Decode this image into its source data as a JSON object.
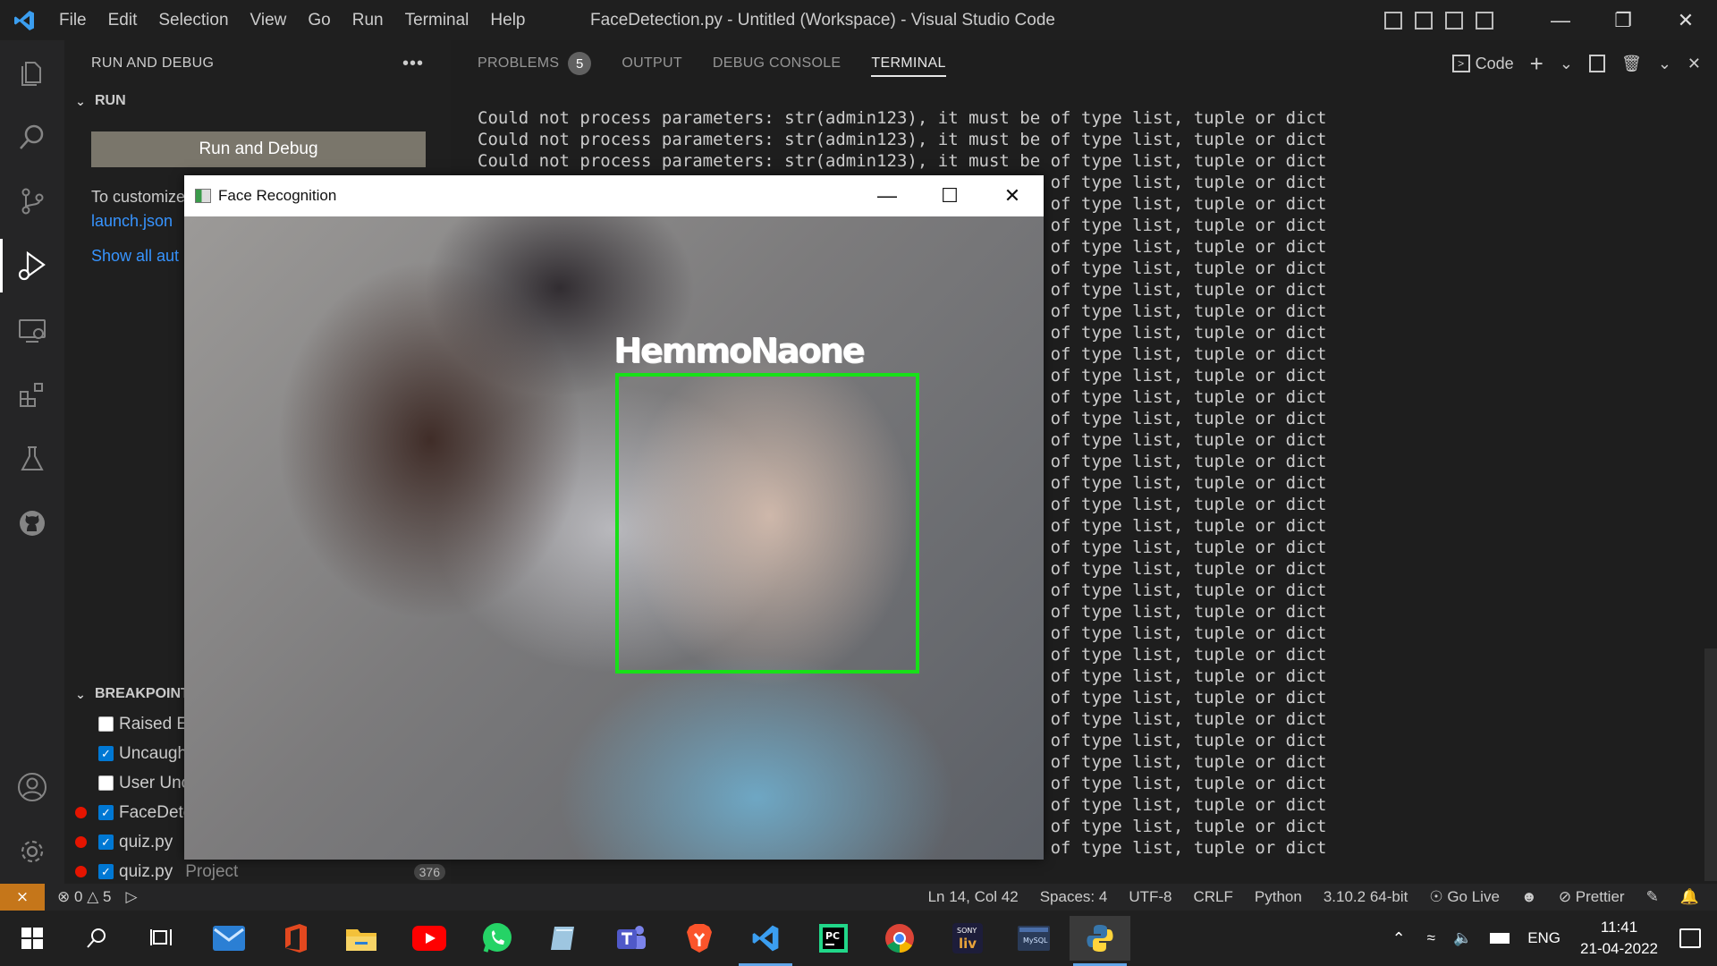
{
  "titlebar": {
    "menu": [
      "File",
      "Edit",
      "Selection",
      "View",
      "Go",
      "Run",
      "Terminal",
      "Help"
    ],
    "title": "FaceDetection.py - Untitled (Workspace) - Visual Studio Code"
  },
  "sidebar": {
    "header": "RUN AND DEBUG",
    "run_section": "RUN",
    "run_button": "Run and Debug",
    "customize_text": "To customize",
    "launch_link": "launch.json",
    "show_all": "Show all aut",
    "breakpoints_title": "BREAKPOINTS",
    "breakpoints": [
      {
        "label": "Raised E",
        "checked": false,
        "dot": false
      },
      {
        "label": "Uncaugh",
        "checked": true,
        "dot": false
      },
      {
        "label": "User Unc",
        "checked": false,
        "dot": false
      },
      {
        "label": "FaceDete",
        "checked": true,
        "dot": true
      },
      {
        "label": "quiz.py",
        "checked": true,
        "dot": true
      },
      {
        "label": "quiz.py",
        "checked": true,
        "dot": true
      }
    ],
    "project_label": "Project",
    "project_count": "376"
  },
  "panel": {
    "tabs": [
      "PROBLEMS",
      "OUTPUT",
      "DEBUG CONSOLE",
      "TERMINAL"
    ],
    "problems_count": "5",
    "active_tab": "TERMINAL",
    "terminal_profile": "Code",
    "terminal_line": "Could not process parameters: str(admin123), it must be of type list, tuple or dict",
    "terminal_line_count": 35
  },
  "cv_window": {
    "title": "Face Recognition",
    "face_label": "HemmoNaone"
  },
  "statusbar": {
    "errors": "0",
    "warnings": "5",
    "position": "Ln 14, Col 42",
    "spaces": "Spaces: 4",
    "encoding": "UTF-8",
    "eol": "CRLF",
    "language": "Python",
    "interpreter": "3.10.2 64-bit",
    "go_live": "Go Live",
    "prettier": "Prettier"
  },
  "taskbar": {
    "language": "ENG",
    "time": "11:41",
    "date": "21-04-2022"
  }
}
